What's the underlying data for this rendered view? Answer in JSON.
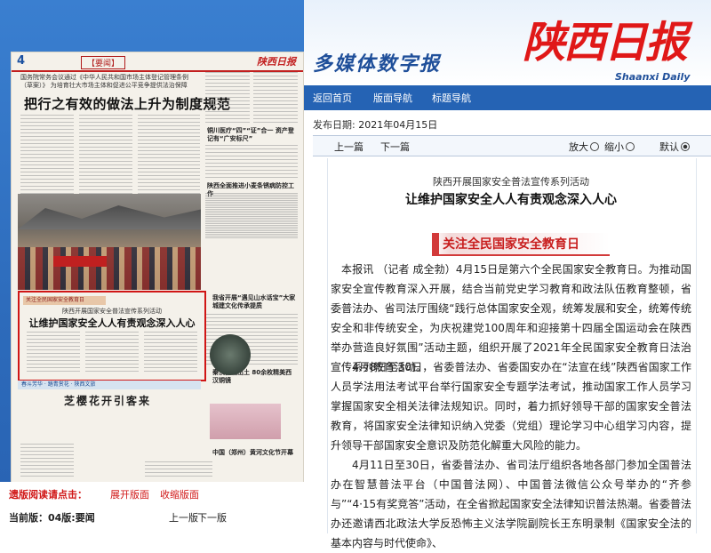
{
  "paper": {
    "page_num": "4",
    "section": "【要闻】",
    "logo": "陕西日报",
    "lead": "国务院常务会议通过《中华人民共和国市场主体登记管理条例（草案）》 为培育壮大市场主体和促进公平竞争提供法治保障",
    "headline": "把行之有效的做法上升为制度规范",
    "side_title_1": "铜川医疗“四”“证”合一 资产登记有“广安标尺”",
    "side_title_2": "陕西全面推进小麦条锈病防控工作",
    "side_title_3": "我省开展“遇见山水话宝”大家城建文化传承提质",
    "side_title_4": "秦汉新城出土 80余枚精美西汉铜镜",
    "side_title_5": "中国（郑州）黄河文化节开幕",
    "highlight_bar": "关注全民国家安全教育日",
    "highlight_sub": "陕西开展国家安全普法宣传系列活动",
    "highlight_title": "让维护国家安全人人有责观念深入人心",
    "strip": "春斗芳华 · 踏青赏花 · 陕西文旅",
    "bottom_title": "芝樱花开引客来"
  },
  "left_links": {
    "hint": "遗版阅读请点击：",
    "expand": "展开版面",
    "collapse": "收缩版面",
    "current": "当前版：04版:要闻",
    "prev": "上一版",
    "next": "下一版"
  },
  "brand": {
    "title": "多媒体数字报",
    "logo_cn": "陕西日报",
    "logo_en": "Shaanxi Daily"
  },
  "nav": {
    "home": "返回首页",
    "layout": "版面导航",
    "headline": "标题导航"
  },
  "date": {
    "label": "发布日期:",
    "value": "2021年04月15日"
  },
  "toolbar": {
    "prev": "上一篇",
    "next": "下一篇",
    "zoom_in": "放大",
    "zoom_out": "缩小",
    "default": "默认"
  },
  "article": {
    "subtitle": "陕西开展国家安全普法宣传系列活动",
    "title": "让维护国家安全人人有责观念深入人心",
    "banner": "关注全民国家安全教育日",
    "p1": "本报讯 （记者 成全勃）4月15日是第六个全民国家安全教育日。为推动国家安全宣传教育深入开展，结合当前党史学习教育和政法队伍教育整顿，省委普法办、省司法厅围绕“践行总体国家安全观，统筹发展和安全，统筹传统安全和非传统安全，为庆祝建党100周年和迎接第十四届全国运动会在陕西举办营造良好氛围”活动主题，组织开展了2021年全民国家安全教育日法治宣传系列教育活动。",
    "p2": "4月8日至30日，省委普法办、省委国安办在“法宣在线”陕西省国家工作人员学法用法考试平台举行国家安全专题学法考试，推动国家工作人员学习掌握国家安全相关法律法规知识。同时，着力抓好领导干部的国家安全普法教育，将国家安全法律知识纳入党委（党组）理论学习中心组学习内容，提升领导干部国家安全意识及防范化解重大风险的能力。",
    "p3": "4月11日至30日，省委普法办、省司法厅组织各地各部门参加全国普法办在智慧普法平台（中国普法网）、中国普法微信公众号举办的“齐参与”“4·15有奖竞答”活动，在全省掀起国家安全法律知识普法热潮。省委普法办还邀请西北政法大学反恐怖主义法学院副院长王东明录制《国家安全法的基本内容与时代使命》、"
  }
}
